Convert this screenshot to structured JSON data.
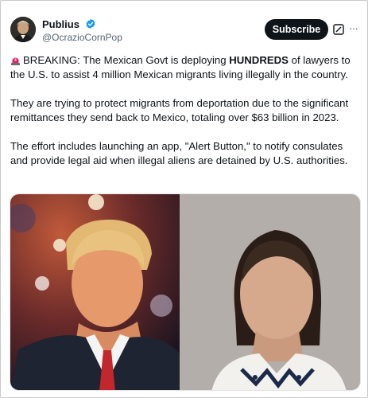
{
  "author": {
    "display_name": "Publius",
    "handle": "@OcrazioCornPop"
  },
  "actions": {
    "subscribe_label": "Subscribe",
    "more_label": "···"
  },
  "post": {
    "p1_prefix": "BREAKING:  The Mexican Govt is deploying ",
    "p1_bold": "HUNDREDS",
    "p1_suffix": " of lawyers to the U.S. to assist 4 million Mexican migrants living illegally in the country.",
    "p2": "They are trying to protect migrants from deportation due to the significant remittances they send back to Mexico, totaling over $63 billion in 2023.",
    "p3": "The effort includes launching an app, \"Alert Button,\" to notify consulates and provide legal aid when illegal aliens are detained by U.S. authorities."
  },
  "icons": {
    "siren": "siren-emoji-icon",
    "verified": "verified-badge-icon",
    "grok": "grok-icon",
    "more": "more-options-icon"
  },
  "colors": {
    "verified_blue": "#1d9bf0",
    "subscribe_bg": "#0f1419",
    "handle_gray": "#536471",
    "siren_red": "#e0245e"
  }
}
